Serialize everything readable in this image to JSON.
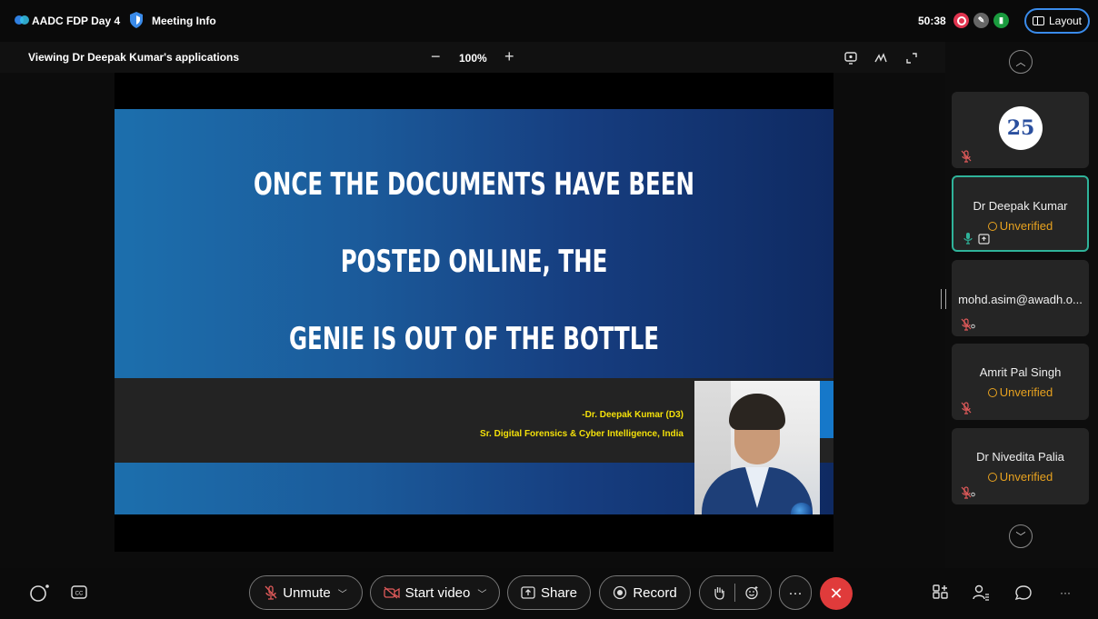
{
  "titlebar": {
    "meeting_name": "AADC FDP Day 4",
    "meeting_info": "Meeting Info",
    "timer": "50:38",
    "layout_label": "Layout"
  },
  "sharebar": {
    "viewing": "Viewing Dr Deepak Kumar's applications",
    "zoom_minus": "−",
    "zoom_level": "100%",
    "zoom_plus": "+"
  },
  "slide": {
    "line1": "ONCE THE DOCUMENTS HAVE BEEN",
    "line2": "POSTED ONLINE, THE",
    "line3": "GENIE IS OUT OF THE BOTTLE",
    "credit_name": "-Dr. Deepak Kumar (D3)",
    "credit_title": "Sr. Digital Forensics & Cyber Intelligence, India"
  },
  "participants": [
    {
      "name": "",
      "status": "",
      "badge": "25"
    },
    {
      "name": "Dr Deepak Kumar",
      "status": "Unverified"
    },
    {
      "name": "mohd.asim@awadh.o...",
      "status": ""
    },
    {
      "name": "Amrit Pal Singh",
      "status": "Unverified"
    },
    {
      "name": "Dr Nivedita Palia",
      "status": "Unverified"
    }
  ],
  "controls": {
    "unmute": "Unmute",
    "start_video": "Start video",
    "share": "Share",
    "record": "Record",
    "more": "···"
  },
  "colors": {
    "accent": "#3a8bea",
    "active_border": "#2fb39a",
    "unverified": "#e8a21f",
    "leave": "#e03b3b",
    "slide_text": "#ffffff",
    "credit_text": "#f3e00a"
  }
}
